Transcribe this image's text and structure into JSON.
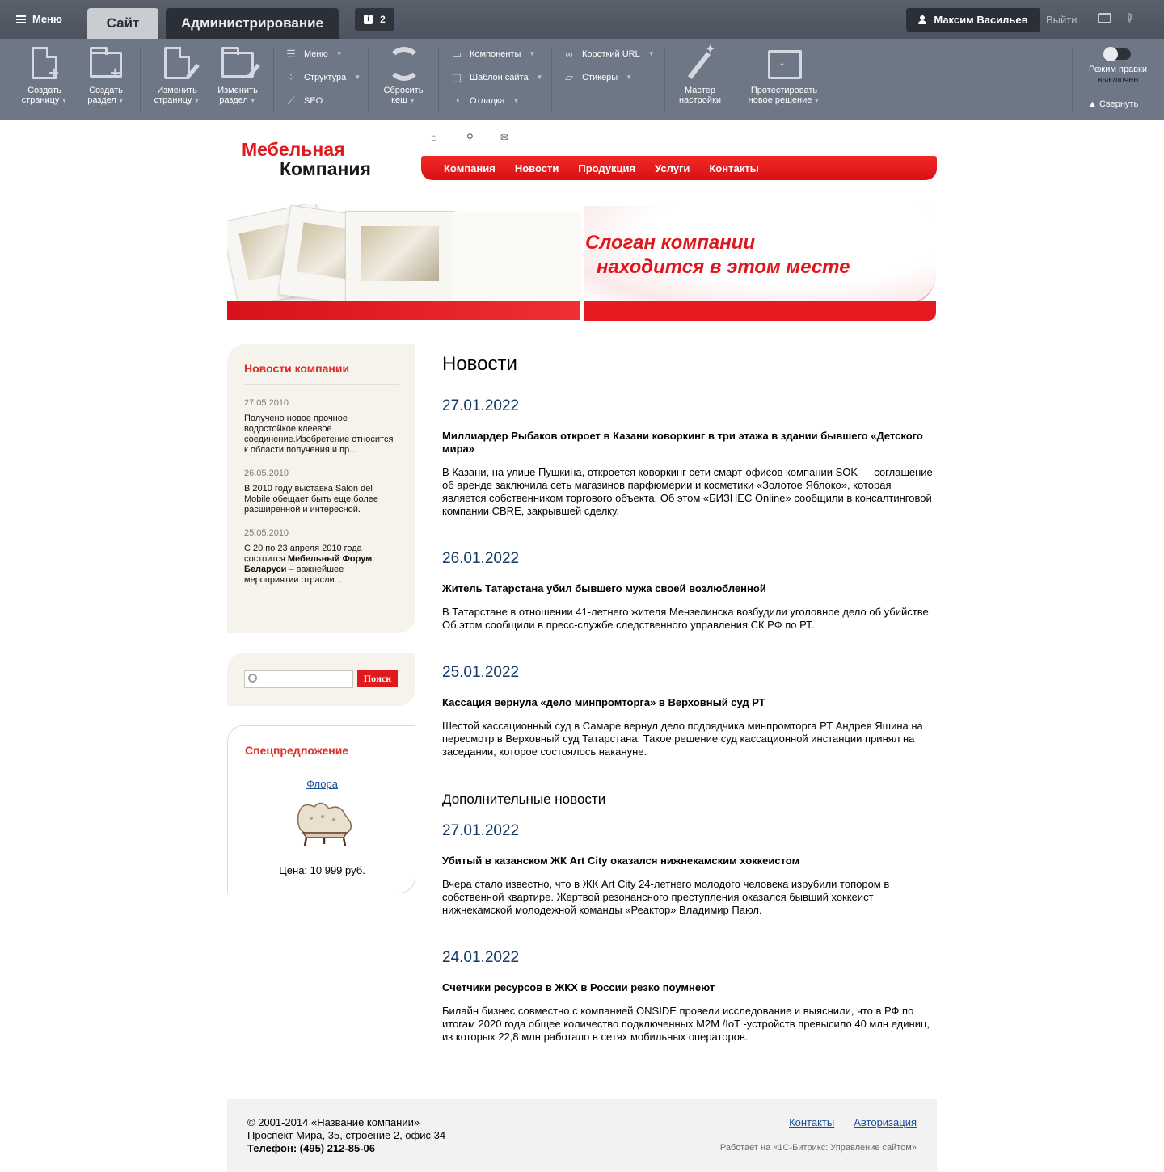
{
  "admin": {
    "menu_label": "Меню",
    "tab_site": "Сайт",
    "tab_admin": "Администрирование",
    "notifications_count": "2",
    "user_name": "Максим Васильев",
    "logout": "Выйти",
    "buttons": {
      "create_page": [
        "Создать",
        "страницу"
      ],
      "create_section": [
        "Создать",
        "раздел"
      ],
      "edit_page": [
        "Изменить",
        "страницу"
      ],
      "edit_section": [
        "Изменить",
        "раздел"
      ],
      "clear_cache": [
        "Сбросить",
        "кеш"
      ],
      "wizard": [
        "Мастер",
        "настройки"
      ],
      "test_solution": [
        "Протестировать",
        "новое решение"
      ]
    },
    "small_menus": {
      "menu": "Меню",
      "structure": "Структура",
      "seo": "SEO",
      "components": "Компоненты",
      "template": "Шаблон сайта",
      "debug": "Отладка",
      "short_url": "Короткий URL",
      "stickers": "Стикеры"
    },
    "edit_mode_label": "Режим правки",
    "edit_mode_state": "выключен",
    "collapse": "Свернуть"
  },
  "site": {
    "logo_line1": "Мебельная",
    "logo_line2": "Компания",
    "nav": [
      "Компания",
      "Новости",
      "Продукция",
      "Услуги",
      "Контакты"
    ],
    "slogan_line1": "Слоган компании",
    "slogan_line2": "находится в этом месте"
  },
  "sidebar": {
    "news_title": "Новости компании",
    "news": [
      {
        "date": "27.05.2010",
        "text": "Получено новое прочное водостойкое клеевое соединение.Изобретение относится к области получения и пр..."
      },
      {
        "date": "26.05.2010",
        "text": "В 2010 году выставка Salon del Mobile обещает быть еще более расширенной и интересной."
      },
      {
        "date": "25.05.2010",
        "text_before": "С 20 по 23 апреля 2010 года состоится ",
        "text_bold": "Мебельный Форум Беларуси",
        "text_after": " – важнейшее мероприятии отрасли..."
      }
    ],
    "search_button": "Поиск",
    "offer_title": "Спецпредложение",
    "offer_link": "Флора",
    "offer_price": "Цена: 10 999 руб."
  },
  "main": {
    "title": "Новости",
    "news": [
      {
        "date": "27.01.2022",
        "title": "Миллиардер Рыбаков откроет в Казани коворкинг в три этажа в здании бывшего «Детского мира»",
        "text": "В Казани, на улице Пушкина, откроется коворкинг сети смарт-офисов компании SOK — соглашение об аренде заключила сеть магазинов парфюмерии и косметики «Золотое Яблоко», которая является собственником торгового объекта. Об этом «БИЗНЕС Online» сообщили в консалтинговой компании CBRE, закрывшей сделку."
      },
      {
        "date": "26.01.2022",
        "title": "Житель Татарстана убил бывшего мужа своей возлюбленной",
        "text": "В Татарстане в отношении 41-летнего жителя Мензелинска возбудили уголовное дело об убийстве. Об этом сообщили в пресс-службе следственного управления СК РФ по РТ."
      },
      {
        "date": "25.01.2022",
        "title": "Кассация вернула «дело минпромторга» в Верховный суд РТ",
        "text": "Шестой кассационный суд в Самаре вернул дело подрядчика минпромторга РТ Андрея Яшина на пересмотр в Верховный суд Татарстана. Такое решение суд кассационной инстанции принял на заседании, которое состоялось накануне."
      }
    ],
    "extra_title": "Дополнительные новости",
    "extra_news": [
      {
        "date": "27.01.2022",
        "title": "Убитый в казанском ЖК Art City оказался нижнекамским хоккеистом",
        "text": "Вчера стало известно, что в ЖК Art City 24-летнего молодого человека изрубили топором в собственной квартире. Жертвой резонансного преступления оказался бывший хоккеист нижнекамской молодежной команды «Реактор» Владимир Паюл."
      },
      {
        "date": "24.01.2022",
        "title": "Счетчики ресурсов в ЖКХ в России резко поумнеют",
        "text": "Билайн бизнес совместно с компанией ONSIDE провели исследование и выяснили, что в РФ по итогам 2020 года общее количество подключенных M2M /IoT -устройств превысило 40 млн единиц, из которых 22,8 млн работало в сетях мобильных операторов."
      }
    ]
  },
  "footer": {
    "copyright": "© 2001-2014 «Название компании»",
    "address": "Проспект Мира, 35, строение 2, офис 34",
    "phone": "Телефон: (495) 212-85-06",
    "link_contacts": "Контакты",
    "link_auth": "Авторизация",
    "powered": "Работает на «1С-Битрикс: Управление сайтом»"
  },
  "colors": {
    "accent": "#e0191f",
    "panel": "#6e7785",
    "date": "#143a63"
  }
}
